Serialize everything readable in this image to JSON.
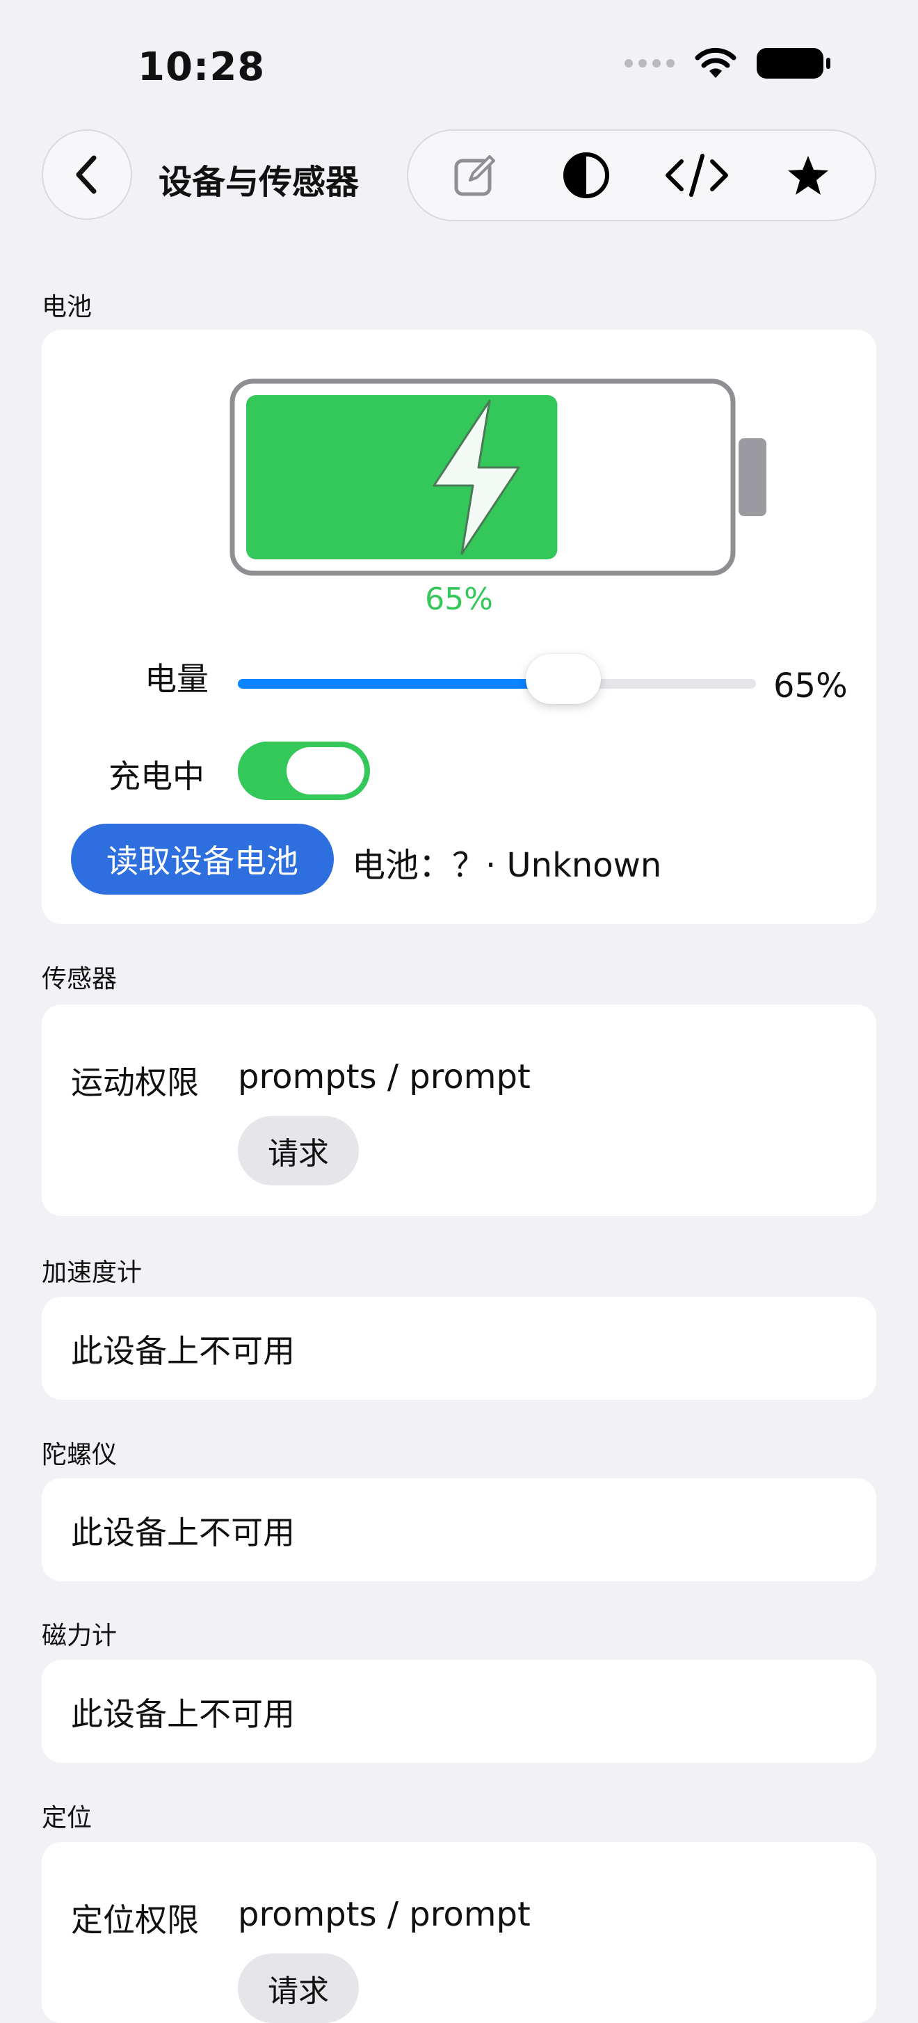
{
  "status": {
    "time": "10:28"
  },
  "nav": {
    "title": "设备与传感器",
    "tools": [
      "edit-icon",
      "contrast-icon",
      "code-icon",
      "star-icon"
    ]
  },
  "battery": {
    "section_label": "电池",
    "level_percent": 65,
    "percent_text": "65%",
    "charging": true,
    "level_label": "电量",
    "slider_value_text": "65%",
    "charging_label": "充电中",
    "read_button": "读取设备电池",
    "status_text": "电池：？· Unknown",
    "fill_color": "#34C759"
  },
  "sensors": {
    "section_label": "传感器",
    "perm_label": "运动权限",
    "perm_value": "prompts / prompt",
    "request_button": "请求"
  },
  "accelerometer": {
    "section_label": "加速度计",
    "text": "此设备上不可用"
  },
  "gyroscope": {
    "section_label": "陀螺仪",
    "text": "此设备上不可用"
  },
  "magnetometer": {
    "section_label": "磁力计",
    "text": "此设备上不可用"
  },
  "location": {
    "section_label": "定位",
    "perm_label": "定位权限",
    "perm_value": "prompts / prompt",
    "request_button": "请求"
  },
  "colors": {
    "accent": "#2E6FE0",
    "slider": "#0A84FF",
    "success": "#34C759",
    "background": "#F2F2F6"
  }
}
